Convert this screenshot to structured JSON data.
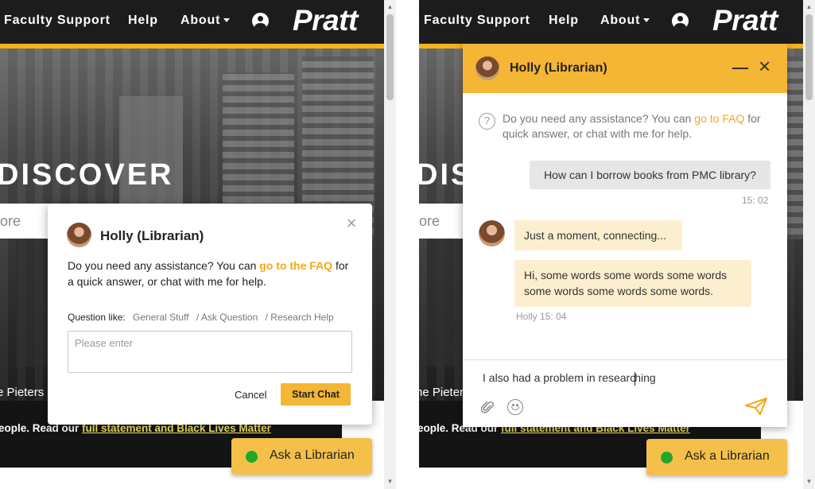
{
  "nav": {
    "faculty_support": "Faculty Support",
    "help": "Help",
    "about": "About",
    "brand": "Pratt"
  },
  "hero": {
    "title": "DISCOVER",
    "search_fragment": "ore",
    "caption_fragment": "e Pieters"
  },
  "statement": {
    "prefix": "eople. Read our ",
    "link": "full statement and Black Lives Matter"
  },
  "right_hero": {
    "title": "DISC",
    "search_fragment": "ore",
    "caption_fragment": "he Pieter"
  },
  "right_statement": {
    "prefix": "eople. Read our ",
    "link": "full statement and Black Lives Matter"
  },
  "popover": {
    "agent_name": "Holly (Librarian)",
    "close_glyph": "×",
    "message_before": "Do you need any assistance? You can ",
    "faq_link": "go to the FAQ",
    "message_after": " for a quick answer, or chat with me for help.",
    "question_label": "Question like:",
    "options": [
      "General Stuff",
      "/ Ask Question",
      "/ Research Help"
    ],
    "input_placeholder": "Please enter",
    "cancel_label": "Cancel",
    "start_label": "Start Chat"
  },
  "ask_button": {
    "label": "Ask a Librarian",
    "status_color": "#1fa82a"
  },
  "chat": {
    "agent_name": "Holly (Librarian)",
    "close_glyph": "×",
    "intro_before": "Do you need any assistance? You can ",
    "intro_link": "go to FAQ",
    "intro_after": " for quick answer, or chat with me for help.",
    "help_glyph": "?",
    "user_message": "How can I borrow books from PMC library?",
    "user_time": "15: 02",
    "agent_message_1": "Just a moment, connecting...",
    "agent_message_2": "Hi, some words some words some words some words some words some words.",
    "agent_meta": "Holly  15: 04",
    "compose_before_caret": "I also had a problem in researc",
    "compose_after_caret": "hing"
  },
  "colors": {
    "accent": "#f5b535",
    "header_bg": "#1c1c1c",
    "agent_bubble": "#fcefd0",
    "user_bubble": "#e6e6e6"
  },
  "icons": [
    "user-icon",
    "close-icon",
    "minimize-icon",
    "help-icon",
    "attach-icon",
    "emoji-icon",
    "send-icon"
  ]
}
